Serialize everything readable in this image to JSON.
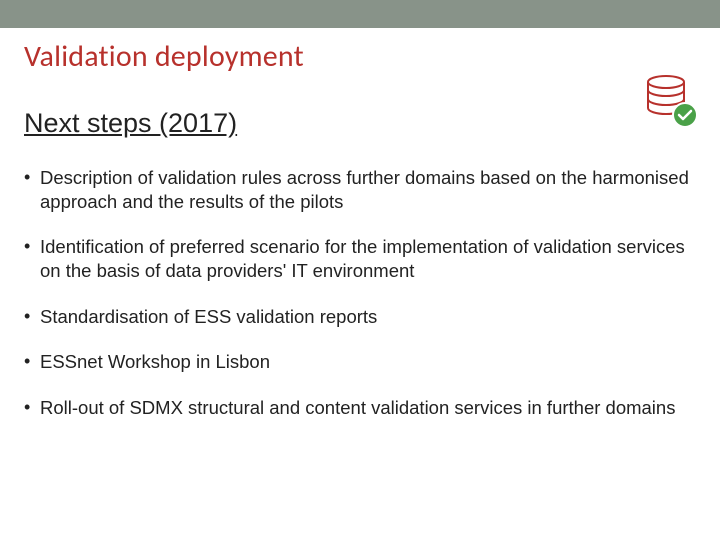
{
  "title": "Validation deployment",
  "subtitle": "Next steps (2017)",
  "bullets": [
    "Description of validation rules across further domains based on the harmonised approach and the results of the pilots",
    "Identification of preferred scenario for the implementation of validation services on the basis of data providers' IT environment",
    "Standardisation of ESS validation reports",
    "ESSnet Workshop in Lisbon",
    "Roll-out of SDMX structural and content validation services in further domains"
  ],
  "colors": {
    "topbar": "#889389",
    "title": "#b7312c",
    "db_stroke": "#b7312c",
    "check_bg": "#4aa148"
  }
}
